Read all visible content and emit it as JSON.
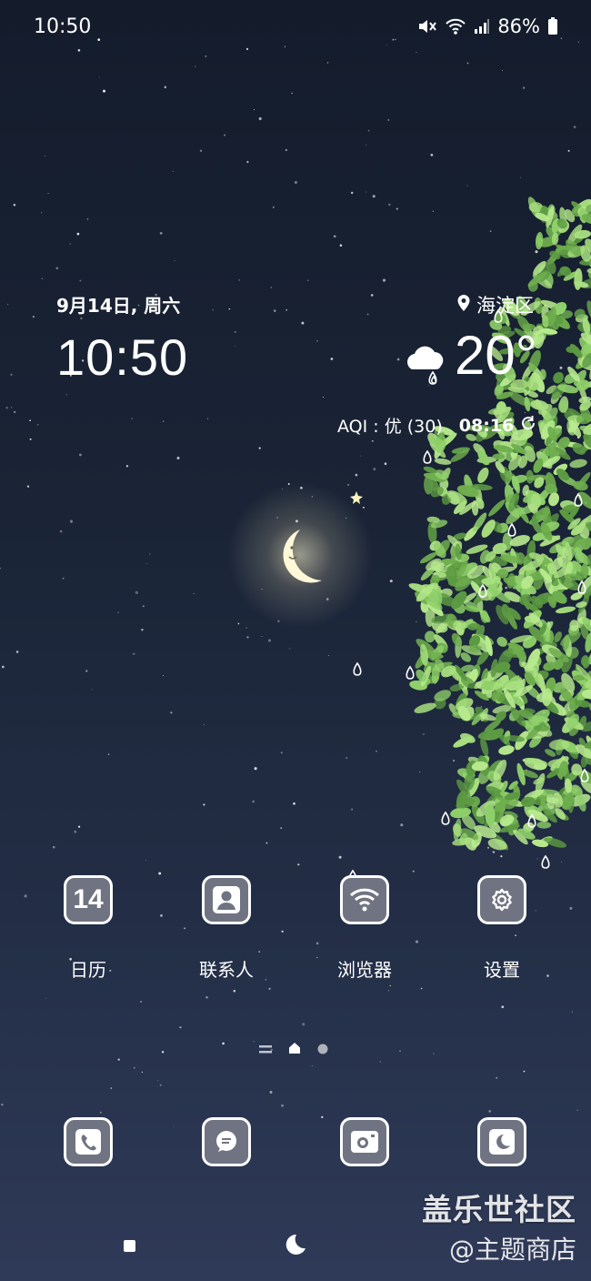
{
  "status_bar": {
    "time": "10:50",
    "battery": "86%",
    "icons": [
      "mute-icon",
      "wifi-icon",
      "signal-icon",
      "battery-icon"
    ]
  },
  "widget": {
    "date": "9月14日, 周六",
    "time": "10:50",
    "location": "海淀区",
    "temperature": "20°",
    "aqi": "AQI : 优 (30)",
    "updated": "08:16",
    "weather_icon": "cloud-rain-icon"
  },
  "apps": [
    {
      "label": "日历",
      "icon": "calendar-icon",
      "icon_text": "14"
    },
    {
      "label": "联系人",
      "icon": "contacts-icon"
    },
    {
      "label": "浏览器",
      "icon": "browser-icon"
    },
    {
      "label": "设置",
      "icon": "settings-icon"
    }
  ],
  "dock": [
    {
      "icon": "phone-icon"
    },
    {
      "icon": "messages-icon"
    },
    {
      "icon": "camera-icon"
    },
    {
      "icon": "moon-icon"
    }
  ],
  "watermark": {
    "line1": "盖乐世社区",
    "line2": "@主题商店"
  },
  "colors": {
    "sky_top": "#141c2c",
    "sky_bottom": "#2f3a58",
    "icon_fill": "#707482",
    "leaf_green": "#8fd06a"
  }
}
